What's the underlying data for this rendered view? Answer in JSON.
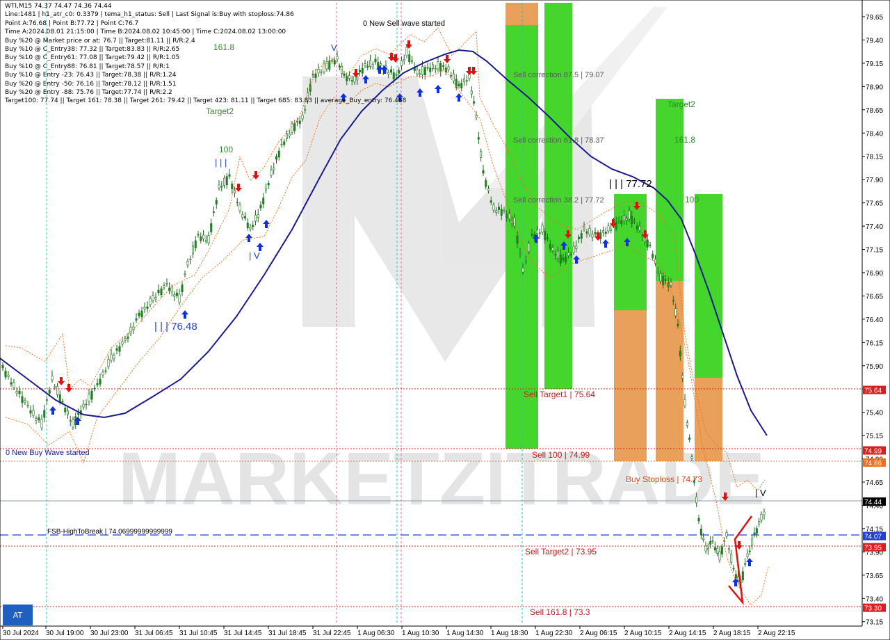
{
  "symbol": "WTI,M15",
  "ohlc": "74.37 74.47 74.36 74.44",
  "info_lines": [
    "WTI,M15  74.37 74.47 74.36 74.44",
    "Line:1481 | h1_atr_c0: 0.3379 | tema_h1_status: Sell | Last Signal is:Buy with stoploss:74.86",
    "Point A:76.68 | Point B:77.72 | Point C:76.7",
    "Time A:2024.08.01 21:15:00 | Time B:2024.08.02 10:45:00 | Time C:2024.08.02 13:00:00",
    "Buy %20 @ Market price or at: 76.7 || Target:81.11 || R/R:2.4",
    "Buy %10 @ C_Entry38: 77.32 || Target:83.83 || R/R:2.65",
    "Buy %10 @ C_Entry61: 77.08 || Target:79.42 || R/R:1.05",
    "Buy %10 @ C_Entry88: 76.81 || Target:78.57 || R/R:1",
    "Buy %10 @ Entry -23: 76.43 || Target:78.38 || R/R:1.24",
    "Buy %20 @ Entry -50: 76.16 || Target:78.12 || R/R:1.51",
    "Buy %20 @ Entry -88: 75.76 || Target:77.74 || R/R:2.2",
    "Target100: 77.74 || Target 161: 78.38 || Target 261: 79.42 || Target 423: 81.11 || Target 685: 83.83 || average_Buy_entry: 76.488"
  ],
  "price_axis": [
    "79.65",
    "79.40",
    "79.15",
    "78.90",
    "78.65",
    "78.40",
    "78.15",
    "77.90",
    "77.65",
    "77.40",
    "77.15",
    "76.90",
    "76.65",
    "76.40",
    "76.15",
    "75.90",
    "75.65",
    "75.40",
    "75.15",
    "74.90",
    "74.65",
    "74.40",
    "74.15",
    "73.90",
    "73.65",
    "73.40",
    "73.15"
  ],
  "price_tags": [
    {
      "value": "75.64",
      "color": "#d92020"
    },
    {
      "value": "74.99",
      "color": "#d92020"
    },
    {
      "value": "74.86",
      "color": "#f07020"
    },
    {
      "value": "74.44",
      "color": "#000000"
    },
    {
      "value": "74.07",
      "color": "#2040d0"
    },
    {
      "value": "73.95",
      "color": "#d92020"
    },
    {
      "value": "73.30",
      "color": "#d92020"
    }
  ],
  "time_axis": [
    "30 Jul 2024",
    "30 Jul 19:00",
    "30 Jul 23:00",
    "31 Jul 06:45",
    "31 Jul 10:45",
    "31 Jul 14:45",
    "31 Jul 18:45",
    "31 Jul 22:45",
    "1 Aug 06:30",
    "1 Aug 10:30",
    "1 Aug 14:30",
    "1 Aug 18:30",
    "1 Aug 22:30",
    "2 Aug 06:15",
    "2 Aug 10:15",
    "2 Aug 14:15",
    "2 Aug 18:15",
    "2 Aug 22:15"
  ],
  "labels": {
    "new_sell_wave": "0 New Sell wave started",
    "new_buy_wave": "0 New Buy Wave started",
    "sell_corr_875": "Sell correction 87.5 | 79.07",
    "sell_corr_618": "Sell correction 61.8 | 78.37",
    "sell_corr_382": "Sell correction 38.2 | 77.72",
    "sell_target1": "Sell Target1 | 75.64",
    "sell_100": "Sell 100 | 74.99",
    "buy_stoploss": "Buy Stoploss | 74.73",
    "sell_target2": "Sell Target2 | 73.95",
    "sell_1618": "Sell 161.8 | 73.3",
    "fsb": "FSB-HighToBreak | 74.06999999999999",
    "target2_left": "Target2",
    "target2_right": "Target2",
    "fib_1618_left": "161.8",
    "fib_100_left": "100",
    "fib_1618_right": "161.8",
    "fib_100_right": "100",
    "wave_76_48": "| | | 76.48",
    "wave_77_72": "| | | 77.72",
    "watermark": "MARKETZITRADE"
  },
  "at_button": "AT",
  "colors": {
    "candle": "#1a8a1a",
    "ma": "#1a1a8c",
    "green_zone": "#44d62c",
    "orange_zone": "#e8a05a",
    "sell_line": "#d92020",
    "buy_line": "#2040d0"
  }
}
